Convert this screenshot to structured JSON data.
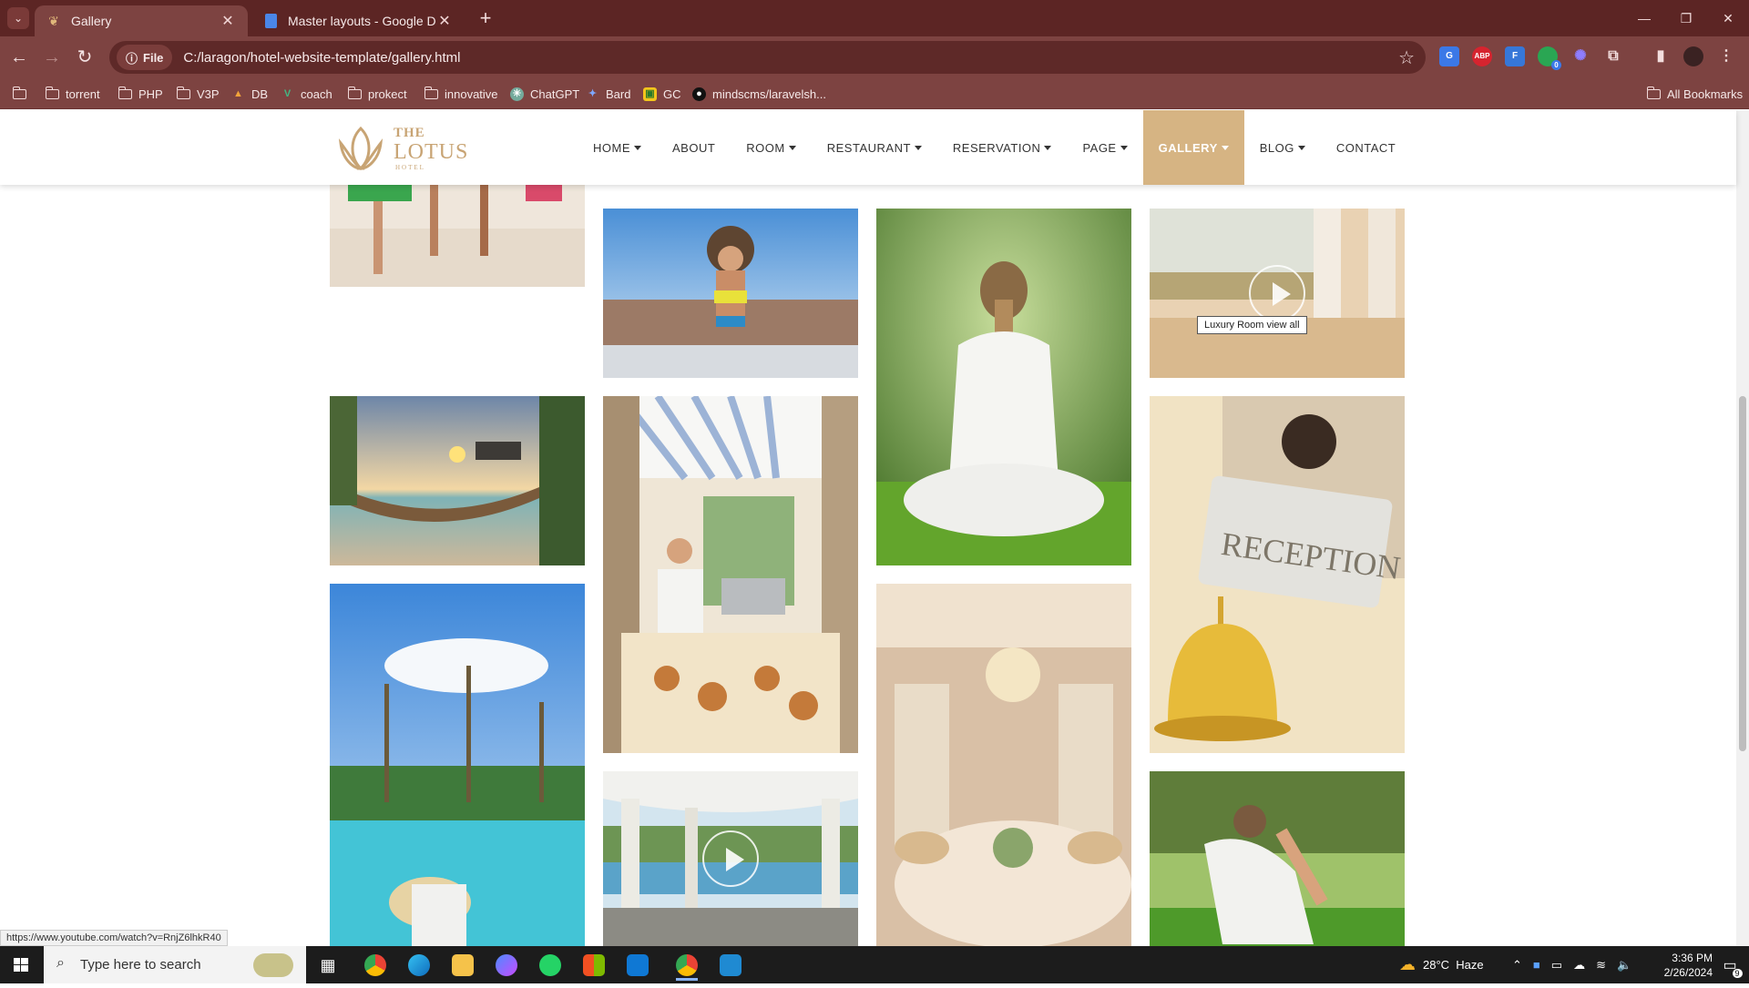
{
  "browser": {
    "tabs": [
      {
        "title": "Gallery",
        "icon": "lotus-favicon"
      },
      {
        "title": "Master layouts - Google Docs",
        "icon": "google-docs-icon"
      }
    ],
    "url_scheme_label": "File",
    "url": "C:/laragon/hotel-website-template/gallery.html",
    "bookmarks": [
      "torrent",
      "PHP",
      "V3P",
      "DB",
      "coach",
      "prokect",
      "innovative",
      "ChatGPT",
      "Bard",
      "GC",
      "mindscms/laravelsh..."
    ],
    "all_bookmarks": "All Bookmarks",
    "extension_badge": "0"
  },
  "site": {
    "logo": {
      "the": "THE",
      "name": "LOTUS",
      "sub": "HOTEL"
    },
    "nav": [
      {
        "label": "HOME",
        "dropdown": true
      },
      {
        "label": "ABOUT",
        "dropdown": false
      },
      {
        "label": "ROOM",
        "dropdown": true
      },
      {
        "label": "RESTAURANT",
        "dropdown": true
      },
      {
        "label": "RESERVATION",
        "dropdown": true
      },
      {
        "label": "PAGE",
        "dropdown": true
      },
      {
        "label": "GALLERY",
        "dropdown": true
      },
      {
        "label": "BLOG",
        "dropdown": true
      },
      {
        "label": "CONTACT",
        "dropdown": false
      }
    ],
    "active_nav": "GALLERY",
    "accent_color": "#d6b483",
    "gallery_tooltip": "Luxury Room view all",
    "status_url": "https://www.youtube.com/watch?v=RnjZ6lhkR40"
  },
  "taskbar": {
    "search_placeholder": "Type here to search",
    "weather": "28°C  Haze",
    "time": "3:36 PM",
    "date": "2/26/2024",
    "notifications": "9"
  }
}
